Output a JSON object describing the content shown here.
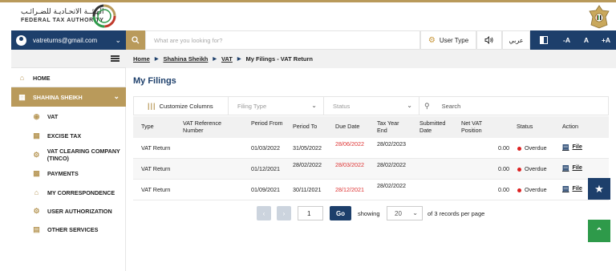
{
  "header": {
    "authority_name_ar": "الهيئــة الاتحـاديـة للضـرائـب",
    "authority_name_en": "FEDERAL TAX AUTHORITY"
  },
  "topbar": {
    "account_email": "vatreturns@gmail.com",
    "search_placeholder": "What are you looking for?",
    "user_type_label": "User Type",
    "language_label": "عربي",
    "font_decrease_label": "-A",
    "font_normal_label": "A",
    "font_increase_label": "+A"
  },
  "sidebar": {
    "home_label": "HOME",
    "profile_label": "SHAHINA SHEIKH",
    "items": [
      {
        "label": "VAT",
        "icon": "hand-coins-icon"
      },
      {
        "label": "EXCISE TAX",
        "icon": "calculator-icon"
      },
      {
        "label": "VAT CLEARING COMPANY (TINCO)",
        "icon": "user-gear-icon"
      },
      {
        "label": "PAYMENTS",
        "icon": "payment-card-icon"
      },
      {
        "label": "MY CORRESPONDENCE",
        "icon": "bank-icon"
      },
      {
        "label": "USER AUTHORIZATION",
        "icon": "user-gear-icon"
      },
      {
        "label": "OTHER SERVICES",
        "icon": "document-icon"
      }
    ]
  },
  "breadcrumb": {
    "items": [
      "Home",
      "Shahina Sheikh",
      "VAT"
    ],
    "current": "My Filings - VAT Return"
  },
  "page": {
    "title": "My Filings"
  },
  "filters": {
    "customize_label": "Customize Columns",
    "filing_type_placeholder": "Filing Type",
    "status_placeholder": "Status",
    "search_placeholder": "Search"
  },
  "table": {
    "columns": [
      "Type",
      "VAT Reference Number",
      "Period From",
      "Period To",
      "Due Date",
      "Tax Year End",
      "Submitted Date",
      "Net VAT Position",
      "Status",
      "Action"
    ],
    "rows": [
      {
        "type": "VAT Return",
        "vat_ref": "",
        "period_from": "01/03/2022",
        "period_to": "31/05/2022",
        "due_date": "28/06/2022",
        "tax_year_end": "28/02/2023",
        "submitted": "",
        "net_vat": "0.00",
        "status": "Overdue",
        "action": "File"
      },
      {
        "type": "VAT Return",
        "vat_ref": "",
        "period_from": "01/12/2021",
        "period_to": "28/02/2022",
        "due_date": "28/03/2022",
        "tax_year_end": "28/02/2022",
        "submitted": "",
        "net_vat": "0.00",
        "status": "Overdue",
        "action": "File"
      },
      {
        "type": "VAT Return",
        "vat_ref": "",
        "period_from": "01/09/2021",
        "period_to": "30/11/2021",
        "due_date": "28/12/2021",
        "tax_year_end": "28/02/2022",
        "submitted": "",
        "net_vat": "0.00",
        "status": "Overdue",
        "action": "File"
      }
    ]
  },
  "pagination": {
    "current_page": "1",
    "go_label": "Go",
    "showing_label": "showing",
    "per_page": "20",
    "records_text": "of 3 records per page"
  },
  "colors": {
    "navy": "#1d3f6b",
    "gold": "#b99a5b",
    "overdue_red": "#d22222",
    "green": "#2e9a4a"
  }
}
